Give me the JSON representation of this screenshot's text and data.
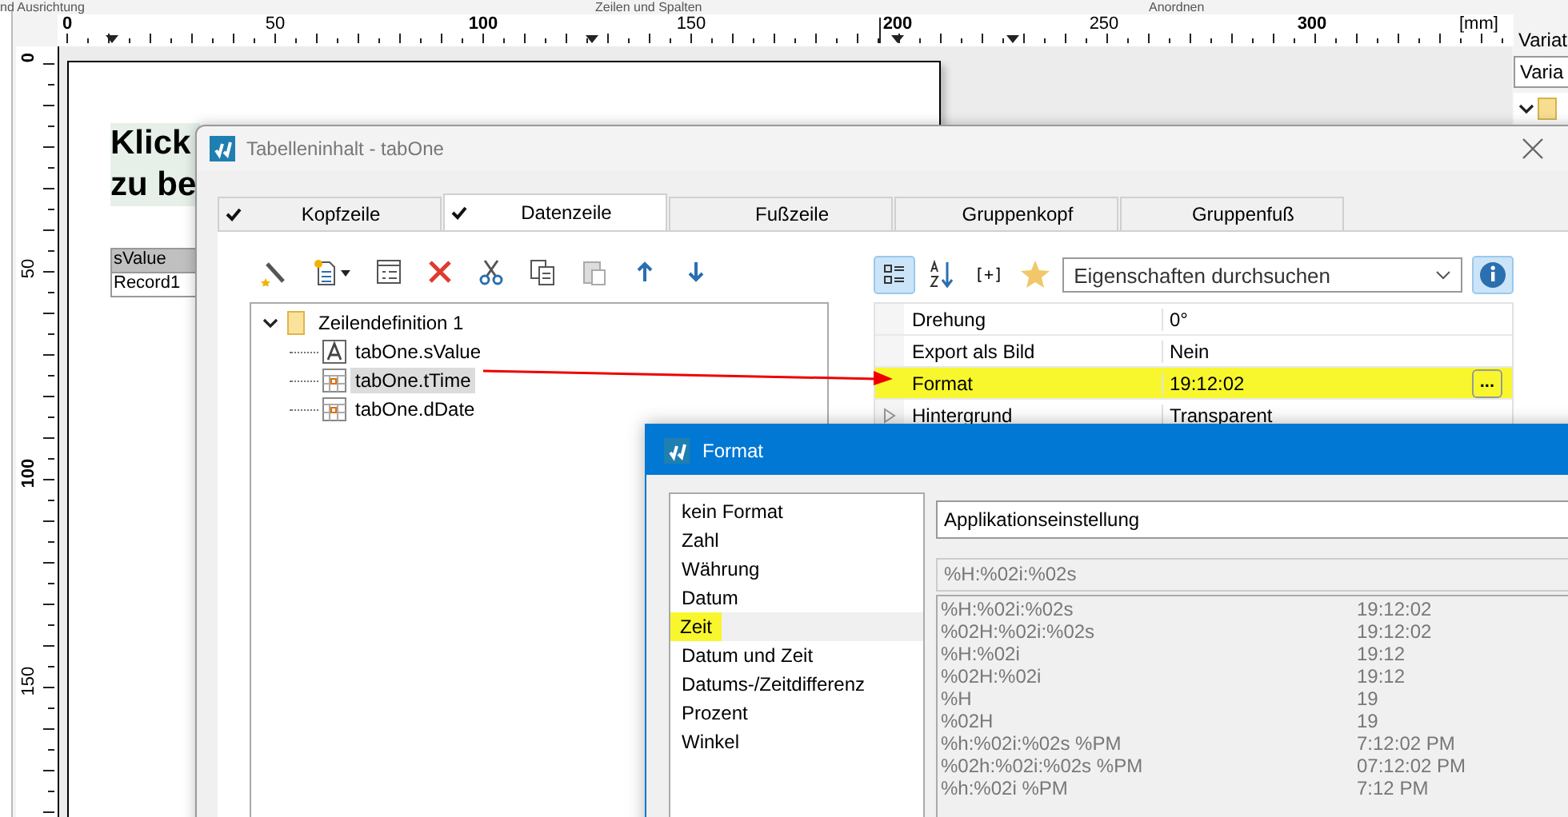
{
  "ribbon_groups": [
    "nd Ausrichtung",
    "Zeilen und Spalten",
    "Anordnen"
  ],
  "ruler": {
    "unit": "[mm]",
    "h_labels": [
      {
        "label": "0",
        "bold": true
      },
      {
        "label": "50",
        "bold": false
      },
      {
        "label": "100",
        "bold": true
      },
      {
        "label": "150",
        "bold": false
      },
      {
        "label": "200",
        "bold": true
      },
      {
        "label": "250",
        "bold": false
      },
      {
        "label": "300",
        "bold": true
      }
    ],
    "v_labels": [
      {
        "label": "0",
        "bold": true
      },
      {
        "label": "50",
        "bold": false
      },
      {
        "label": "100",
        "bold": true
      },
      {
        "label": "150",
        "bold": false
      }
    ]
  },
  "page": {
    "heading_lines": [
      "Klick",
      "zu be"
    ],
    "table_header": "sValue",
    "table_cell": "Record1"
  },
  "variables_panel": {
    "title": "Variat",
    "field": "Varia"
  },
  "table_dialog": {
    "title": "Tabelleninhalt - tabOne",
    "tabs": [
      {
        "label": "Kopfzeile",
        "checked": true,
        "selected": false
      },
      {
        "label": "Datenzeile",
        "checked": true,
        "selected": true
      },
      {
        "label": "Fußzeile",
        "checked": false,
        "selected": false
      },
      {
        "label": "Gruppenkopf",
        "checked": false,
        "selected": false
      },
      {
        "label": "Gruppenfuß",
        "checked": false,
        "selected": false
      }
    ],
    "tree": {
      "label": "Zeilendefinition  1",
      "expanded": true,
      "children": [
        {
          "label": "tabOne.sValue",
          "kind": "text",
          "selected": false
        },
        {
          "label": "tabOne.tTime",
          "kind": "date",
          "selected": true
        },
        {
          "label": "tabOne.dDate",
          "kind": "date",
          "selected": false
        }
      ]
    },
    "property_toolbar": {
      "expand_label": "[+]",
      "search_placeholder": "Eigenschaften durchsuchen"
    },
    "properties": [
      {
        "name": "Drehung",
        "value": "0°",
        "highlighted": false,
        "expandable": false,
        "has_button": false
      },
      {
        "name": "Export als Bild",
        "value": "Nein",
        "highlighted": false,
        "expandable": false,
        "has_button": false
      },
      {
        "name": "Format",
        "value": "19:12:02",
        "highlighted": true,
        "expandable": false,
        "has_button": true,
        "button_label": "..."
      },
      {
        "name": "Hintergrund",
        "value": "Transparent",
        "highlighted": false,
        "expandable": true,
        "has_button": false
      }
    ]
  },
  "format_dialog": {
    "title": "Format",
    "categories": [
      {
        "label": "kein Format",
        "selected": false,
        "highlighted": false
      },
      {
        "label": "Zahl",
        "selected": false,
        "highlighted": false
      },
      {
        "label": "Währung",
        "selected": false,
        "highlighted": false
      },
      {
        "label": "Datum",
        "selected": false,
        "highlighted": false
      },
      {
        "label": "Zeit",
        "selected": true,
        "highlighted": true
      },
      {
        "label": "Datum und Zeit",
        "selected": false,
        "highlighted": false
      },
      {
        "label": "Datums-/Zeitdifferenz",
        "selected": false,
        "highlighted": false
      },
      {
        "label": "Prozent",
        "selected": false,
        "highlighted": false
      },
      {
        "label": "Winkel",
        "selected": false,
        "highlighted": false
      }
    ],
    "mode": "Applikationseinstellung",
    "format_string": "%H:%02i:%02s",
    "formats": [
      {
        "pattern": "%H:%02i:%02s",
        "sample": "19:12:02"
      },
      {
        "pattern": "%02H:%02i:%02s",
        "sample": "19:12:02"
      },
      {
        "pattern": "%H:%02i",
        "sample": "19:12"
      },
      {
        "pattern": "%02H:%02i",
        "sample": "19:12"
      },
      {
        "pattern": "%H",
        "sample": "19"
      },
      {
        "pattern": "%02H",
        "sample": "19"
      },
      {
        "pattern": "%h:%02i:%02s %PM",
        "sample": "7:12:02 PM"
      },
      {
        "pattern": "%02h:%02i:%02s %PM",
        "sample": "07:12:02 PM"
      },
      {
        "pattern": "%h:%02i %PM",
        "sample": "7:12 PM"
      }
    ]
  }
}
